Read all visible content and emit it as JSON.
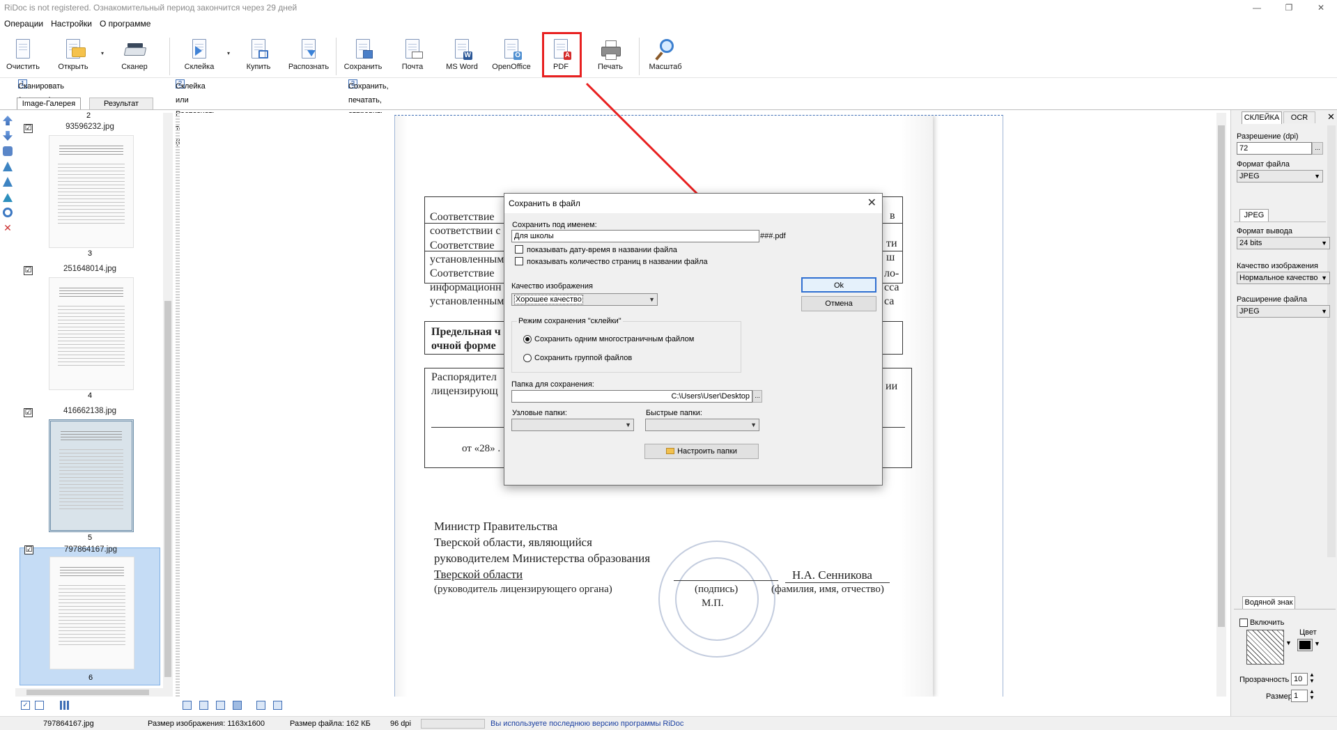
{
  "window": {
    "title": "RiDoc is not registered. Ознакомительный период закончится через 29 дней",
    "minimize": "—",
    "restore": "❐",
    "close": "✕"
  },
  "menu": [
    "Операции",
    "Настройки",
    "О программе"
  ],
  "toolbar": {
    "items": [
      {
        "label": "Очистить",
        "icon": "clear-icon"
      },
      {
        "label": "Открыть",
        "icon": "open-icon"
      },
      {
        "label": "Сканер",
        "icon": "scanner-icon"
      },
      {
        "label": "Склейка",
        "icon": "glue-icon"
      },
      {
        "label": "Купить",
        "icon": "buy-icon"
      },
      {
        "label": "Распознать",
        "icon": "recognize-icon"
      },
      {
        "label": "Сохранить",
        "icon": "save-icon"
      },
      {
        "label": "Почта",
        "icon": "mail-icon"
      },
      {
        "label": "MS Word",
        "icon": "word-icon"
      },
      {
        "label": "OpenOffice",
        "icon": "openoffice-icon"
      },
      {
        "label": "PDF",
        "icon": "pdf-icon"
      },
      {
        "label": "Печать",
        "icon": "print-icon"
      },
      {
        "label": "Масштаб",
        "icon": "zoom-icon"
      }
    ],
    "dropdown_glyph": "▾"
  },
  "steps": [
    {
      "num": "1",
      "text": "Сканировать (открыть) документ"
    },
    {
      "num": "2",
      "text": "Склейка или Распознать текст (OCR)"
    },
    {
      "num": "3",
      "text": "Сохранить, печатать, отправить по почте документ"
    }
  ],
  "tabs": {
    "gallery": "Image-Галерея",
    "result": "Результат"
  },
  "gallery": {
    "top_number": "2",
    "items": [
      {
        "file": "93596232.jpg",
        "page": "3",
        "checked": "☑",
        "selected": false
      },
      {
        "file": "251648014.jpg",
        "page": "4",
        "checked": "☑",
        "selected": false
      },
      {
        "file": "416662138.jpg",
        "page": "5",
        "checked": "☑",
        "selected": false
      },
      {
        "file": "797864167.jpg",
        "page": "6",
        "checked": "☑",
        "selected": true
      }
    ]
  },
  "document_text": {
    "rows": [
      "Соответствие",
      "соответствии с",
      "Соответствие",
      "установленным",
      "Соответствие",
      "информационн",
      "установленным"
    ],
    "right_frag": [
      "в",
      "ти",
      "ш",
      "ло-",
      "сса",
      "са"
    ],
    "bold1": "Предельная ч",
    "bold2": "очной форме",
    "disp1": "Распорядител",
    "disp2": "лицензирующ",
    "disp_right": "ии",
    "date": "от «28» .",
    "min1": "Министр Правительства",
    "min2": "Тверской области, являющийся",
    "min3": "руководителем Министерства образования",
    "min4": "Тверской области",
    "min5": "(руководитель лицензирующего органа)",
    "sign": "(подпись)",
    "mp": "М.П.",
    "name": "Н.А. Сенникова",
    "fio": "(фамилия, имя, отчество)"
  },
  "dialog": {
    "title": "Сохранить в файл",
    "close": "✕",
    "save_as_label": "Сохранить под именем:",
    "filename": "Для школы",
    "suffix": "###.pdf",
    "cb_datetime": "показывать дату-время в названии файла",
    "cb_pagecount": "показывать количество страниц в названии файла",
    "quality_label": "Качество изображения",
    "quality_value": "Хорошее качество",
    "mode_label": "Режим сохранения \"склейки\"",
    "radio_multi": "Сохранить одним многостраничным файлом",
    "radio_group": "Сохранить группой файлов",
    "folder_label": "Папка для сохранения:",
    "folder_value": "C:\\Users\\User\\Desktop",
    "browse": "...",
    "node_folders": "Узловые папки:",
    "quick_folders": "Быстрые папки:",
    "setup_folders": "Настроить папки",
    "ok": "Ok",
    "cancel": "Отмена"
  },
  "right_panel": {
    "tab_glue": "СКЛЕЙКА",
    "tab_ocr": "OCR",
    "close": "✕",
    "dpi_label": "Разрешение (dpi)",
    "dpi_value": "72",
    "dpi_btn": "...",
    "format_label": "Формат файла",
    "format_value": "JPEG",
    "jpeg_tab": "JPEG",
    "output_label": "Формат вывода",
    "output_value": "24 bits",
    "imgq_label": "Качество изображения",
    "imgq_value": "Нормальное качество",
    "ext_label": "Расширение файла",
    "ext_value": "JPEG",
    "watermark_tab": "Водяной знак",
    "enable": "Включить",
    "color": "Цвет",
    "transparency": "Прозрачность",
    "transparency_value": "10",
    "size": "Размер",
    "size_value": "1"
  },
  "status": {
    "file": "797864167.jpg",
    "img_size": "Размер изображения: 1163x1600",
    "file_size": "Размер файла: 162 КБ",
    "dpi": "96 dpi",
    "version": "Вы используете последнюю версию программы RiDoc"
  },
  "colors": {
    "accent_red": "#e82020",
    "selection": "#c5dcf5",
    "status_blue": "#1a3fa0"
  }
}
